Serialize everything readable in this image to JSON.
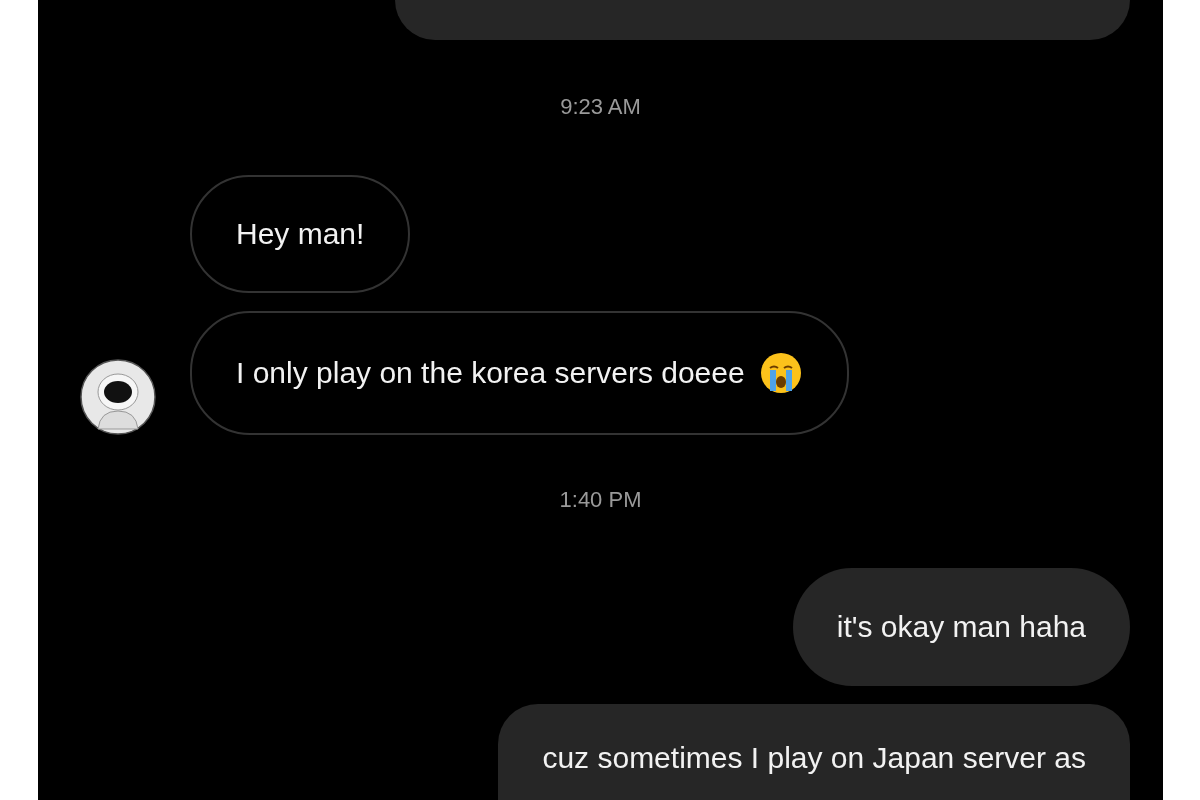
{
  "messages": [
    {
      "kind": "time",
      "text": "9:23 AM"
    },
    {
      "kind": "incoming",
      "text": "Hey man!",
      "avatar": false,
      "emoji": false
    },
    {
      "kind": "incoming",
      "text": "I only play on the korea servers doeee",
      "avatar": true,
      "emoji": true
    },
    {
      "kind": "time",
      "text": "1:40 PM"
    },
    {
      "kind": "outgoing",
      "text": "it's okay man haha",
      "cut": false
    },
    {
      "kind": "outgoing",
      "text": "cuz sometimes I play on Japan server as",
      "cut": true
    }
  ]
}
